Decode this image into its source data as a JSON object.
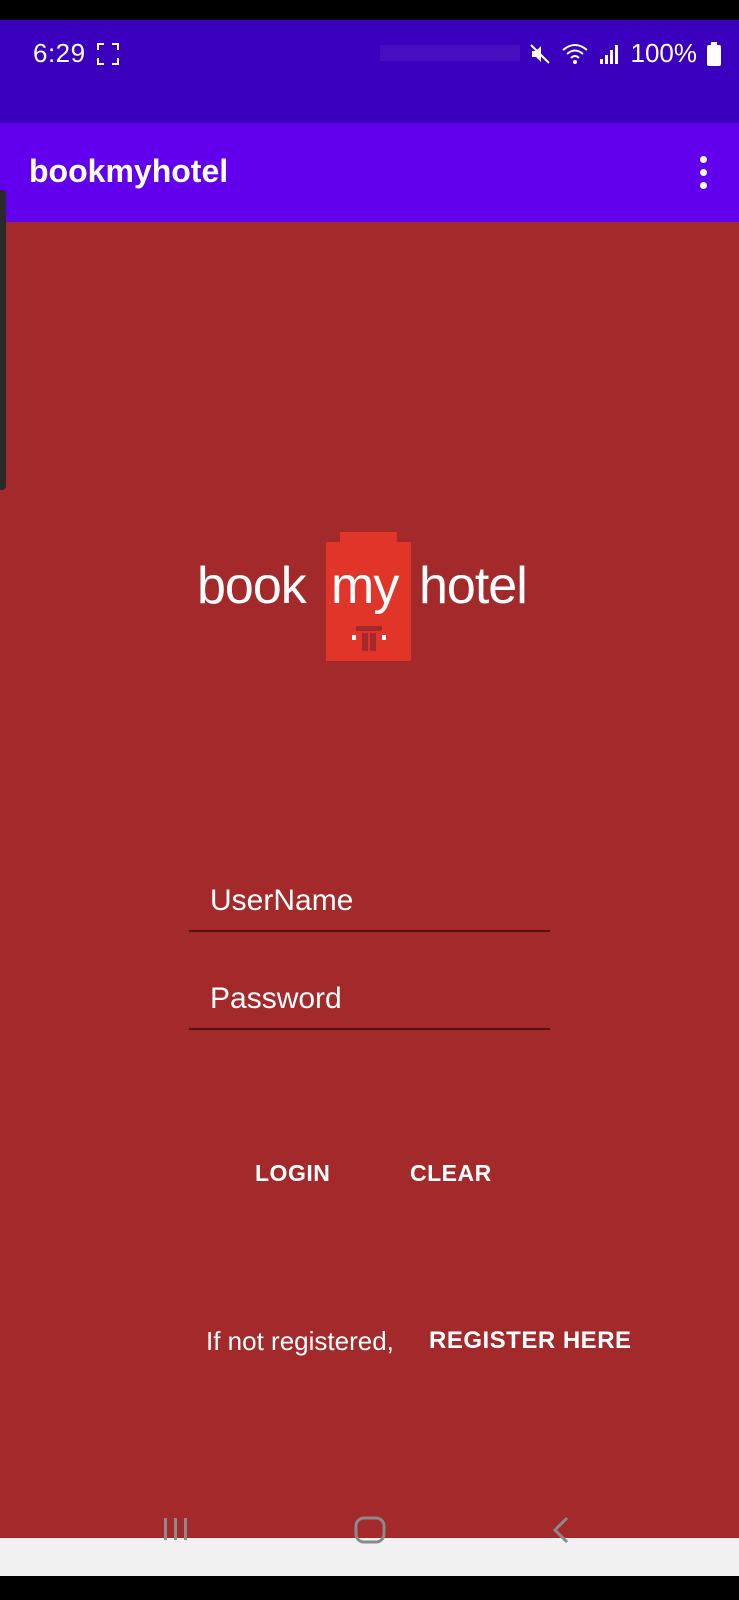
{
  "status_bar": {
    "time": "6:29",
    "battery_percent": "100%",
    "icons": [
      "screenshot-icon",
      "mute-icon",
      "wifi-icon",
      "signal-icon",
      "battery-icon"
    ]
  },
  "app_bar": {
    "title": "bookmyhotel",
    "menu_icon": "more-vert-icon"
  },
  "logo": {
    "word1": "book",
    "word2": "my",
    "word3": "hotel"
  },
  "form": {
    "username_placeholder": "UserName",
    "username_value": "",
    "password_placeholder": "Password",
    "password_value": ""
  },
  "actions": {
    "login_label": "LOGIN",
    "clear_label": "CLEAR"
  },
  "register": {
    "prompt": "If not registered,",
    "link_label": "REGISTER HERE"
  },
  "nav": {
    "icons": [
      "recents-icon",
      "home-icon",
      "back-icon"
    ]
  },
  "colors": {
    "status_bar": "#3a00bd",
    "app_bar": "#6200ee",
    "background": "#a3292a",
    "logo_accent": "#e1352a"
  }
}
